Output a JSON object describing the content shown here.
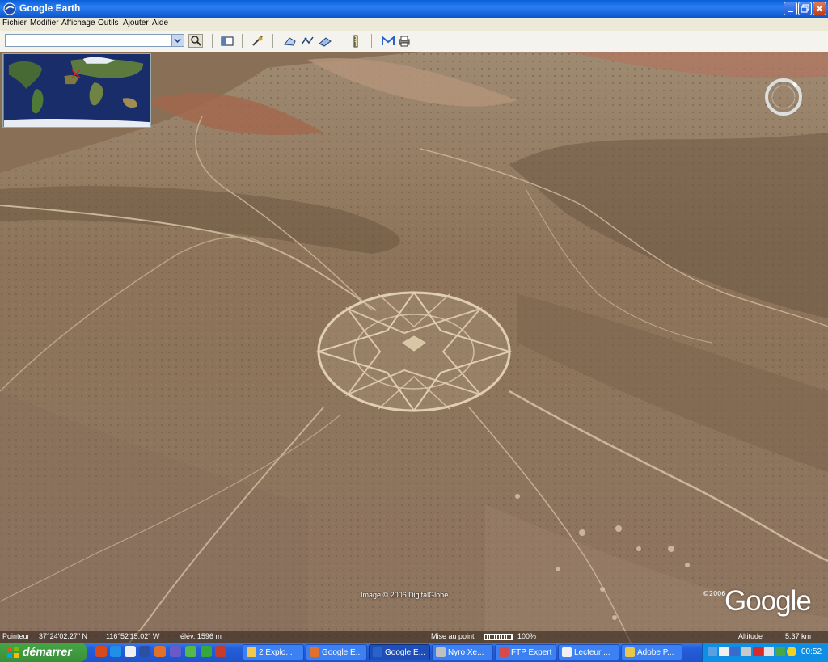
{
  "window": {
    "title": "Google Earth"
  },
  "menu": {
    "items": [
      "Fichier",
      "Modifier",
      "Affichage",
      "Outils",
      "Ajouter",
      "Aide"
    ]
  },
  "search": {
    "value": ""
  },
  "map": {
    "attribution": "Image © 2006 DigitalGlobe",
    "logo_year": "©2006",
    "logo": "Google"
  },
  "status": {
    "pointer_label": "Pointeur",
    "latitude": "37°24'02.27\" N",
    "longitude": "116°52'15.02\" W",
    "elevation": "élév. 1596 m",
    "focus_label": "Mise au point",
    "stream_percent": "100%",
    "altitude_label": "Altitude",
    "altitude_value": "5.37 km"
  },
  "taskbar": {
    "start_label": "démarrer",
    "tasks": [
      {
        "label": "2 Explo..."
      },
      {
        "label": "Google E..."
      },
      {
        "label": "Google E..."
      },
      {
        "label": "Nyro Xe..."
      },
      {
        "label": "FTP Expert"
      },
      {
        "label": "Lecteur ..."
      },
      {
        "label": "Adobe P..."
      }
    ],
    "clock": "00:52"
  },
  "colors": {
    "terrain": "#8c7258",
    "titlebar": "#0a5fd8",
    "taskbar": "#245edb",
    "start": "#3a8f3a"
  }
}
